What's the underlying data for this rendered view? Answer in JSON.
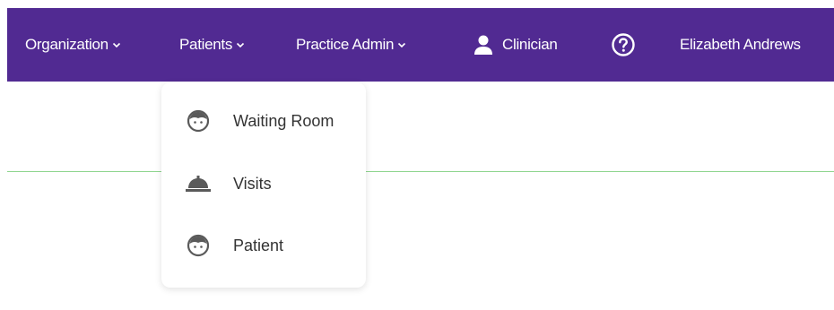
{
  "navbar": {
    "items": [
      {
        "label": "Organization",
        "icon": "chevron-down-icon"
      },
      {
        "label": "Patients",
        "icon": "chevron-down-icon"
      },
      {
        "label": "Practice Admin",
        "icon": "chevron-down-icon"
      }
    ],
    "role_label": "Clinician",
    "role_icon": "person-icon",
    "help_icon": "help-circle-icon",
    "user_name": "Elizabeth Andrews"
  },
  "patients_menu": {
    "items": [
      {
        "label": "Waiting Room",
        "icon": "face-icon"
      },
      {
        "label": "Visits",
        "icon": "service-bell-icon"
      },
      {
        "label": "Patient",
        "icon": "face-icon"
      }
    ]
  },
  "colors": {
    "navbar_bg": "#512a92",
    "navbar_text": "#ffffff",
    "divider": "#8fd58f",
    "menu_text": "#333333",
    "icon_gray": "#5a5a5a"
  }
}
